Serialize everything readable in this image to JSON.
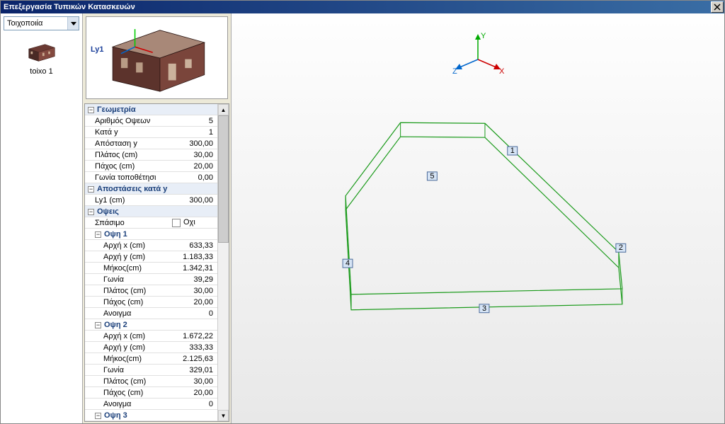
{
  "window": {
    "title": "Επεξεργασία Τυπικών Κατασκευών"
  },
  "combo": {
    "value": "Τοιχοποιία"
  },
  "item": {
    "label": "toixo 1"
  },
  "previewLabel": "Ly1",
  "axes": {
    "x": "X",
    "y": "Y",
    "z": "Z"
  },
  "faceLabels": [
    "1",
    "2",
    "3",
    "4",
    "5"
  ],
  "sections": {
    "geometry": "Γεωμετρία",
    "distances": "Αποστάσεις κατά y",
    "faces": "Οψεις",
    "face1": "Οψη 1",
    "face2": "Οψη 2",
    "face3": "Οψη 3"
  },
  "rows": {
    "numFaces": {
      "l": "Αριθμός Οψεων",
      "v": "5"
    },
    "kataY": {
      "l": "Κατά y",
      "v": "1"
    },
    "distY": {
      "l": "Απόσταση y",
      "v": "300,00"
    },
    "width": {
      "l": "Πλάτος (cm)",
      "v": "30,00"
    },
    "thick": {
      "l": "Πάχος (cm)",
      "v": "20,00"
    },
    "angle": {
      "l": "Γωνία τοποθέτησι",
      "v": "0,00"
    },
    "ly1": {
      "l": "Ly1 (cm)",
      "v": "300,00"
    },
    "break": {
      "l": "Σπάσιμο",
      "v": "Οχι"
    },
    "f1x": {
      "l": "Αρχή x (cm)",
      "v": "633,33"
    },
    "f1y": {
      "l": "Αρχή y (cm)",
      "v": "1.183,33"
    },
    "f1len": {
      "l": "Μήκος(cm)",
      "v": "1.342,31"
    },
    "f1ang": {
      "l": "Γωνία",
      "v": "39,29"
    },
    "f1w": {
      "l": "Πλάτος (cm)",
      "v": "30,00"
    },
    "f1t": {
      "l": "Πάχος (cm)",
      "v": "20,00"
    },
    "f1o": {
      "l": "Ανοιγμα",
      "v": "0"
    },
    "f2x": {
      "l": "Αρχή x (cm)",
      "v": "1.672,22"
    },
    "f2y": {
      "l": "Αρχή y (cm)",
      "v": "333,33"
    },
    "f2len": {
      "l": "Μήκος(cm)",
      "v": "2.125,63"
    },
    "f2ang": {
      "l": "Γωνία",
      "v": "329,01"
    },
    "f2w": {
      "l": "Πλάτος (cm)",
      "v": "30,00"
    },
    "f2t": {
      "l": "Πάχος (cm)",
      "v": "20,00"
    },
    "f2o": {
      "l": "Ανοιγμα",
      "v": "0"
    }
  }
}
